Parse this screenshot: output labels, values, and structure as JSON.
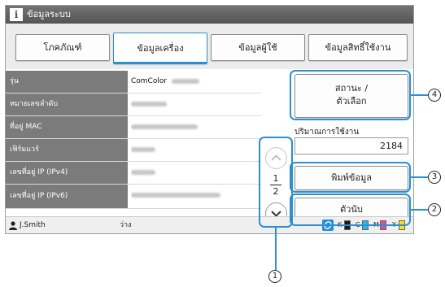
{
  "window": {
    "title": "ข้อมูลระบบ"
  },
  "tabs": [
    {
      "label": "โภคภัณฑ์",
      "active": false
    },
    {
      "label": "ข้อมูลเครื่อง",
      "active": true
    },
    {
      "label": "ข้อมูลผู้ใช้",
      "active": false
    },
    {
      "label": "ข้อมูลสิทธิ์ใช้งาน",
      "active": false
    }
  ],
  "machine_info": {
    "rows": [
      {
        "label": "รุ่น",
        "value": "ComColor"
      },
      {
        "label": "หมายเลขลำดับ",
        "value": ""
      },
      {
        "label": "ที่อยู่ MAC",
        "value": ""
      },
      {
        "label": "เฟิร์มแวร์",
        "value": ""
      },
      {
        "label": "เลขที่อยู่ IP (IPv4)",
        "value": ""
      },
      {
        "label": "เลขที่อยู่ IP (IPv6)",
        "value": ""
      }
    ]
  },
  "pager": {
    "current": "1",
    "total": "2"
  },
  "side": {
    "status_options_line1": "สถานะ /",
    "status_options_line2": "ตัวเลือก",
    "usage_label": "ปริมาณการใช้งาน",
    "usage_value": "2184",
    "print_info": "พิมพ์ข้อมูล",
    "counter": "ตัวนับ"
  },
  "status_bar": {
    "user": "J.Smith",
    "state": "ว่าง",
    "inks": [
      {
        "label": "K",
        "color": "#1a1a1a"
      },
      {
        "label": "C",
        "color": "#29b6e8"
      },
      {
        "label": "M",
        "color": "#e8489a"
      },
      {
        "label": "Y",
        "color": "#f2e21c"
      }
    ]
  },
  "callouts": {
    "c1": "1",
    "c2": "2",
    "c3": "3",
    "c4": "4"
  },
  "icons": {
    "window": "info-icon",
    "up": "chevron-up-icon",
    "down": "chevron-down-icon",
    "user": "user-icon",
    "ink": "ink-status-icon"
  },
  "colors": {
    "accent": "#2c8fcf",
    "label_bg": "#7b7b7b",
    "title_bg": "#5c5c5c"
  }
}
